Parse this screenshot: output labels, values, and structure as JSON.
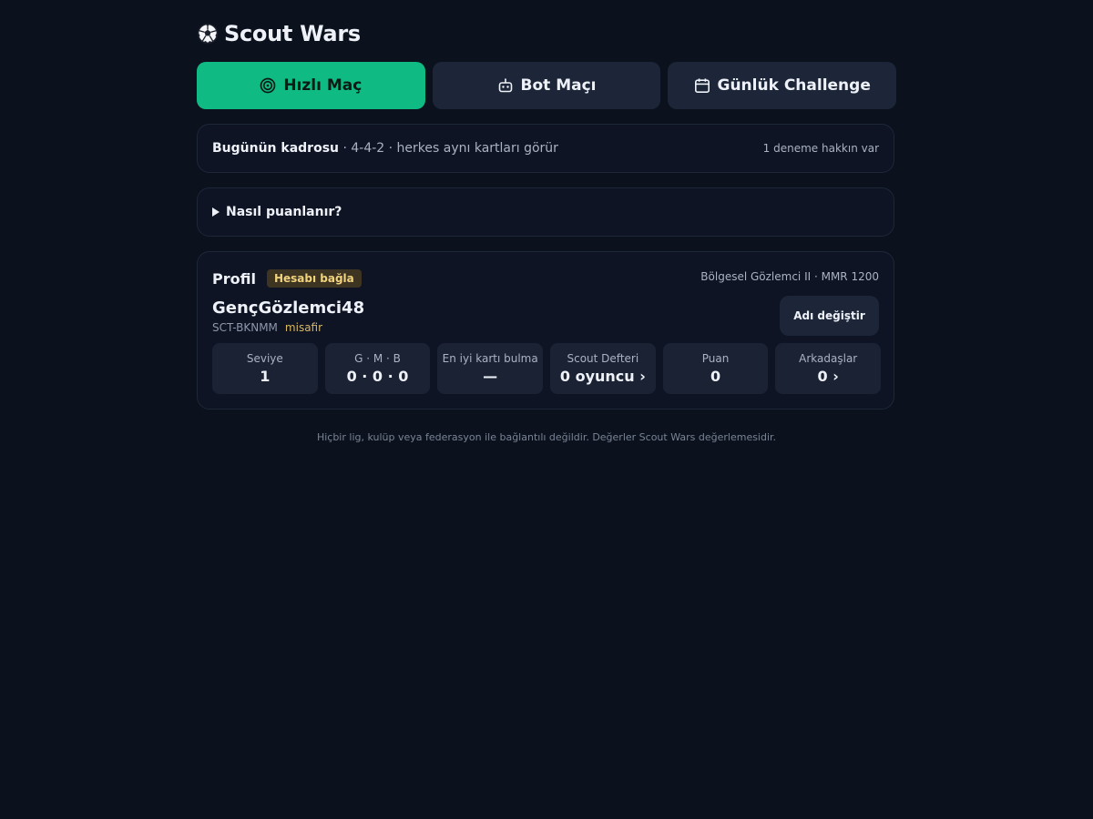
{
  "app": {
    "title": "Scout Wars",
    "logo_icon": "soccer-ball-icon"
  },
  "modes": [
    {
      "label": "Hızlı Maç",
      "icon": "target-icon",
      "active": true
    },
    {
      "label": "Bot Maçı",
      "icon": "robot-icon",
      "active": false
    },
    {
      "label": "Günlük Challenge",
      "icon": "calendar-icon",
      "active": false
    }
  ],
  "squad": {
    "title": "Bugünün kadrosu",
    "details": " · 4-4-2 · herkes aynı kartları görür",
    "attempts": "1 deneme hakkın var"
  },
  "howto": {
    "label": "Nasıl puanlanır?"
  },
  "profile": {
    "title": "Profil",
    "link_badge": "Hesabı bağla",
    "rank": "Bölgesel Gözlemci II · MMR 1200",
    "username": "GençGözlemci48",
    "user_id": "SCT-BKNMM",
    "status": "misafir",
    "rename_label": "Adı değiştir",
    "stats": [
      {
        "label": "Seviye",
        "value": "1"
      },
      {
        "label": "G · M · B",
        "value": "0 · 0 · 0"
      },
      {
        "label": "En iyi kartı bulma",
        "value": "—"
      },
      {
        "label": "Scout Defteri",
        "value": "0 oyuncu ›"
      },
      {
        "label": "Puan",
        "value": "0"
      },
      {
        "label": "Arkadaşlar",
        "value": "0 ›"
      }
    ]
  },
  "footer": {
    "disclaimer": "Hiçbir lig, kulüp veya federasyon ile bağlantılı değildir. Değerler Scout Wars değerlemesidir."
  },
  "colors": {
    "background": "#0b111d",
    "accent": "#10bb83",
    "card": "#0e1424",
    "badge": "#3d3522",
    "guest": "#d9b860"
  }
}
